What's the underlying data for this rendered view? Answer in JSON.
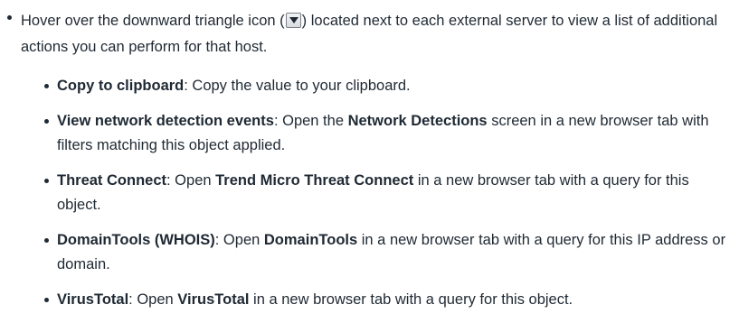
{
  "intro": {
    "text_before_icon": "Hover over the downward triangle icon (",
    "icon": "dropdown-triangle-icon",
    "text_after_icon": ") located next to each external server to view a list of additional actions you can perform for that host."
  },
  "actions": [
    {
      "label": "Copy to clipboard",
      "parts": [
        {
          "text": ": Copy the value to your clipboard.",
          "bold": false
        }
      ]
    },
    {
      "label": "View network detection events",
      "parts": [
        {
          "text": ": Open the ",
          "bold": false
        },
        {
          "text": "Network Detections",
          "bold": true
        },
        {
          "text": " screen in a new browser tab with filters matching this object applied.",
          "bold": false
        }
      ]
    },
    {
      "label": "Threat Connect",
      "parts": [
        {
          "text": ": Open ",
          "bold": false
        },
        {
          "text": "Trend Micro Threat Connect",
          "bold": true
        },
        {
          "text": " in a new browser tab with a query for this object.",
          "bold": false
        }
      ]
    },
    {
      "label": "DomainTools (WHOIS)",
      "parts": [
        {
          "text": ": Open ",
          "bold": false
        },
        {
          "text": "DomainTools",
          "bold": true
        },
        {
          "text": " in a new browser tab with a query for this IP address or domain.",
          "bold": false
        }
      ]
    },
    {
      "label": "VirusTotal",
      "parts": [
        {
          "text": ": Open ",
          "bold": false
        },
        {
          "text": "VirusTotal",
          "bold": true
        },
        {
          "text": " in a new browser tab with a query for this object.",
          "bold": false
        }
      ]
    }
  ]
}
